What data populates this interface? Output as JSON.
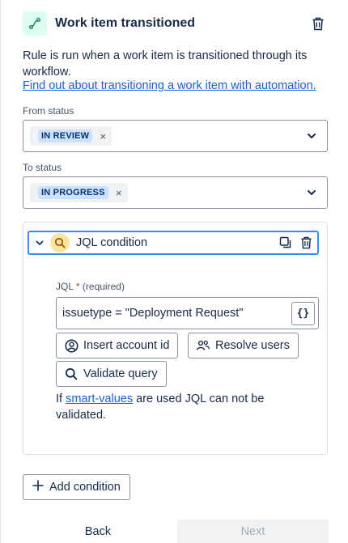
{
  "header": {
    "title": "Work item transitioned",
    "trigger_icon": "transition-icon",
    "delete_icon": "trash-icon"
  },
  "description": "Rule is run when a work item is transitioned through its workflow.",
  "help_link": "Find out about transitioning a work item with automation.",
  "from_status": {
    "label": "From status",
    "selected": "IN REVIEW",
    "remove_icon": "×"
  },
  "to_status": {
    "label": "To status",
    "selected": "IN PROGRESS",
    "remove_icon": "×"
  },
  "condition": {
    "title": "JQL condition",
    "jql_label": "JQL",
    "required_star": "*",
    "required_text": "(required)",
    "jql_value": "issuetype = \"Deployment Request\"",
    "braces_label": "{}",
    "insert_account_label": "Insert account id",
    "resolve_users_label": "Resolve users",
    "validate_label": "Validate query",
    "note_prefix": "If ",
    "note_link": "smart-values",
    "note_suffix": " are used JQL can not be validated."
  },
  "add_condition_label": "Add condition",
  "footer": {
    "back_label": "Back",
    "next_label": "Next"
  },
  "colors": {
    "accent": "#0c66e4",
    "focus_border": "#388bff",
    "lozenge_bg": "#cce0ff",
    "trigger_bg": "#dcfff1",
    "condition_icon_bg": "#f8e6a0"
  }
}
